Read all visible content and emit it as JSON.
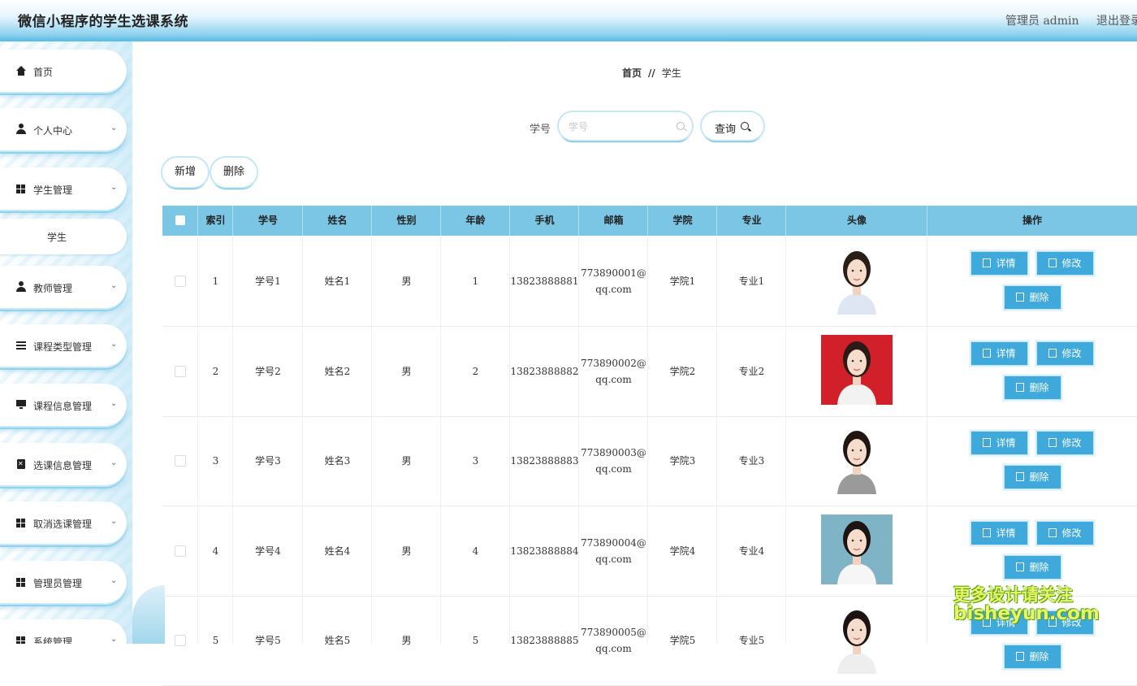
{
  "header": {
    "title": "微信小程序的学生选课系统",
    "admin_label": "管理员 admin",
    "logout_label": "退出登录"
  },
  "sidebar": {
    "items": [
      {
        "label": "首页",
        "icon": "home-icon"
      },
      {
        "label": "个人中心",
        "icon": "user-icon"
      },
      {
        "label": "学生管理",
        "icon": "grid-icon"
      },
      {
        "label": "教师管理",
        "icon": "user-icon"
      },
      {
        "label": "课程类型管理",
        "icon": "list-icon"
      },
      {
        "label": "课程信息管理",
        "icon": "monitor-icon"
      },
      {
        "label": "选课信息管理",
        "icon": "clipboard-icon"
      },
      {
        "label": "取消选课管理",
        "icon": "grid-icon"
      },
      {
        "label": "管理员管理",
        "icon": "grid-icon"
      },
      {
        "label": "系统管理",
        "icon": "grid-icon"
      }
    ],
    "sub_item": "学生",
    "chevron": "⌄"
  },
  "breadcrumb": {
    "home": "首页",
    "sep": "//",
    "current": "学生"
  },
  "search": {
    "label": "学号",
    "placeholder": "学号",
    "query_label": "查询"
  },
  "toolbar": {
    "add_label": "新增",
    "delete_label": "删除"
  },
  "table": {
    "headers": [
      "索引",
      "学号",
      "姓名",
      "性别",
      "年龄",
      "手机",
      "邮箱",
      "学院",
      "专业",
      "头像",
      "操作"
    ],
    "rows": [
      {
        "index": "1",
        "student_no": "学号1",
        "name": "姓名1",
        "gender": "男",
        "age": "1",
        "phone": "13823888881",
        "email_a": "773890001@",
        "email_b": "qq.com",
        "college": "学院1",
        "major": "专业1"
      },
      {
        "index": "2",
        "student_no": "学号2",
        "name": "姓名2",
        "gender": "男",
        "age": "2",
        "phone": "13823888882",
        "email_a": "773890002@",
        "email_b": "qq.com",
        "college": "学院2",
        "major": "专业2"
      },
      {
        "index": "3",
        "student_no": "学号3",
        "name": "姓名3",
        "gender": "男",
        "age": "3",
        "phone": "13823888883",
        "email_a": "773890003@",
        "email_b": "qq.com",
        "college": "学院3",
        "major": "专业3"
      },
      {
        "index": "4",
        "student_no": "学号4",
        "name": "姓名4",
        "gender": "男",
        "age": "4",
        "phone": "13823888884",
        "email_a": "773890004@",
        "email_b": "qq.com",
        "college": "学院4",
        "major": "专业4"
      },
      {
        "index": "5",
        "student_no": "学号5",
        "name": "姓名5",
        "gender": "男",
        "age": "5",
        "phone": "13823888885",
        "email_a": "773890005@",
        "email_b": "qq.com",
        "college": "学院5",
        "major": "专业5"
      }
    ],
    "actions": {
      "detail": "详情",
      "edit": "修改",
      "delete": "删除"
    }
  },
  "watermark": {
    "line1": "更多设计请关注",
    "line2": "bisheyun.com"
  },
  "colors": {
    "accent": "#3fa9dc",
    "header_row": "#7ac6e4",
    "border_glow": "#5cbde6"
  }
}
